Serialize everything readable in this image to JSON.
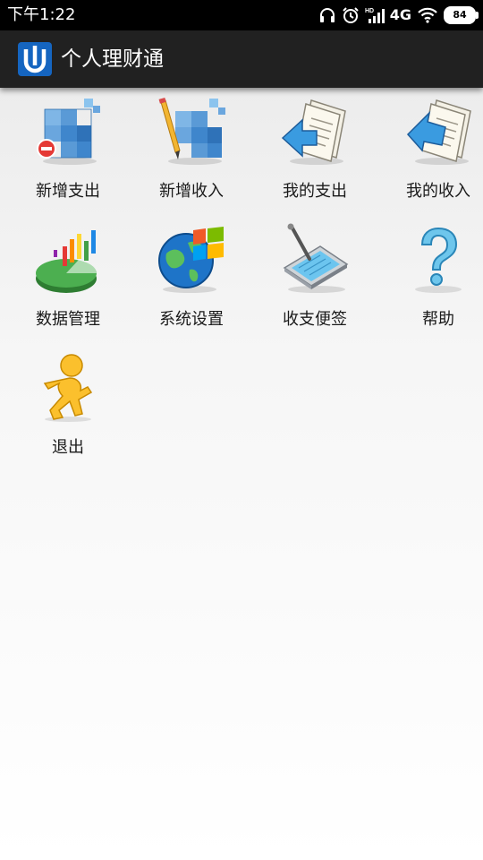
{
  "status_bar": {
    "time": "下午1:22",
    "network": "4G",
    "battery": "84",
    "icons": [
      "headphones-icon",
      "alarm-icon",
      "signal-icon",
      "wifi-icon",
      "battery-icon"
    ]
  },
  "app_bar": {
    "title": "个人理财通",
    "logo": "app-logo-icon"
  },
  "menu": {
    "items": [
      {
        "label": "新增支出",
        "icon": "add-expense-icon"
      },
      {
        "label": "新增收入",
        "icon": "add-income-icon"
      },
      {
        "label": "我的支出",
        "icon": "my-expense-icon"
      },
      {
        "label": "我的收入",
        "icon": "my-income-icon"
      },
      {
        "label": "数据管理",
        "icon": "data-management-icon"
      },
      {
        "label": "系统设置",
        "icon": "system-settings-icon"
      },
      {
        "label": "收支便签",
        "icon": "notes-icon"
      },
      {
        "label": "帮助",
        "icon": "help-icon"
      },
      {
        "label": "退出",
        "icon": "exit-icon"
      }
    ]
  },
  "colors": {
    "status_bar_bg": "#000000",
    "action_bar_bg": "#212121",
    "logo_blue": "#1565c0",
    "label_text": "#1a1a1a"
  }
}
